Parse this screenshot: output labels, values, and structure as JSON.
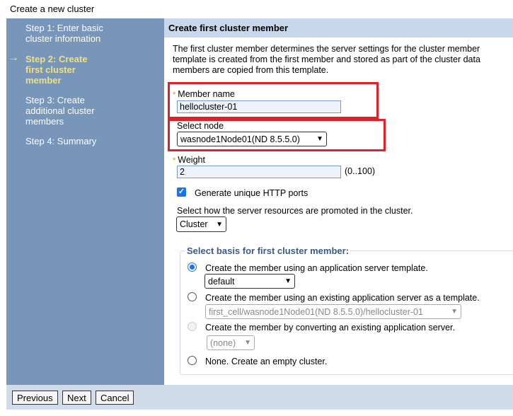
{
  "window": {
    "title": "Create a new cluster"
  },
  "sidebar": {
    "steps": [
      {
        "line1": "Step 1: Enter basic",
        "line2": "cluster information"
      },
      {
        "line1": "Step 2: Create",
        "line2": "first cluster",
        "line3": "member"
      },
      {
        "line1": "Step 3: Create",
        "line2": "additional cluster",
        "line3": "members"
      },
      {
        "line1": "Step 4: Summary"
      }
    ],
    "current_arrow": "→"
  },
  "panel": {
    "heading": "Create first cluster member",
    "description": [
      "The first cluster member determines the server settings for the cluster member",
      "template is created from the first member and stored as part of the cluster data",
      "members are copied from this template."
    ]
  },
  "form": {
    "required_mark": "*",
    "member_name_label": "Member name",
    "member_name_value": "hellocluster-01",
    "select_node_label": "Select node",
    "select_node_value": "wasnode1Node01(ND 8.5.5.0)",
    "weight_label": "Weight",
    "weight_value": "2",
    "weight_range": "(0..100)",
    "unique_ports_label": "Generate unique HTTP ports",
    "unique_ports_checked": true,
    "promote_label": "Select how the server resources are promoted in the cluster.",
    "promote_value": "Cluster"
  },
  "basis": {
    "legend": "Select basis for first cluster member:",
    "opt_template": "Create the member using an application server template.",
    "template_value": "default",
    "opt_existing": "Create the member using an existing application server as a template.",
    "existing_value": "first_cell/wasnode1Node01(ND 8.5.5.0)/hellocluster-01",
    "opt_convert": "Create the member by converting an existing application server.",
    "convert_value": "(none)",
    "opt_none": "None. Create an empty cluster."
  },
  "buttons": {
    "previous": "Previous",
    "next": "Next",
    "cancel": "Cancel"
  },
  "colors": {
    "sidebar": "#7896b9",
    "active_step": "#f0e080",
    "highlight": "#e0202a",
    "accent": "#1a73e8"
  }
}
